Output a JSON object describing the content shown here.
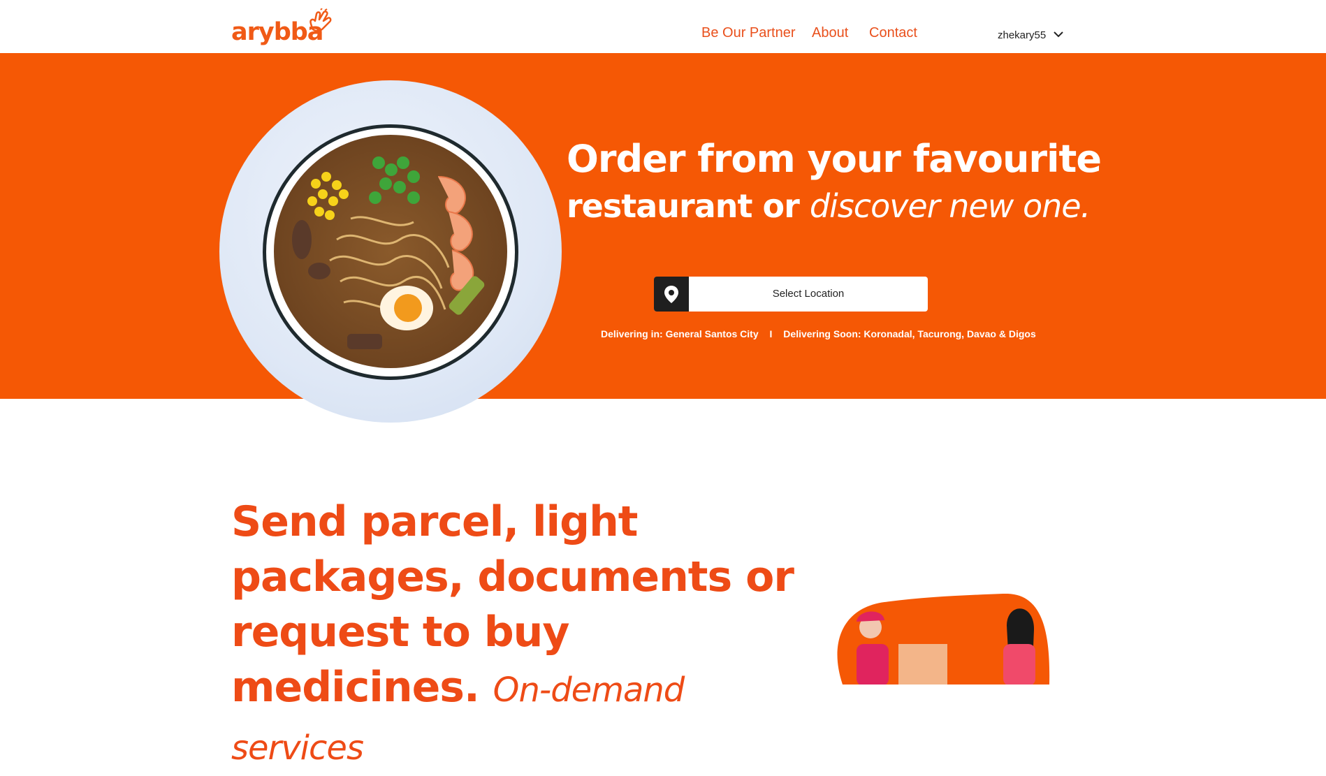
{
  "header": {
    "logo_text": "arybba",
    "nav": [
      "Be Our Partner",
      "About",
      "Contact"
    ],
    "username": "zhekary55"
  },
  "hero": {
    "title_line1": "Order from your favourite",
    "title_line2_bold": "restaurant or",
    "title_line2_italic": "discover new one.",
    "location_button": "Select Location",
    "delivering_in": "Delivering in: General Santos City",
    "separator": "I",
    "delivering_soon": "Delivering Soon: Koronadal, Tacurong, Davao & Digos"
  },
  "services": {
    "headline": "Send parcel, light packages, documents or request to buy medicines.",
    "tagline": "On-demand services"
  },
  "colors": {
    "brand": "#f55805",
    "text_brand": "#ee4b16",
    "icon_dark": "#1f1f1f"
  }
}
